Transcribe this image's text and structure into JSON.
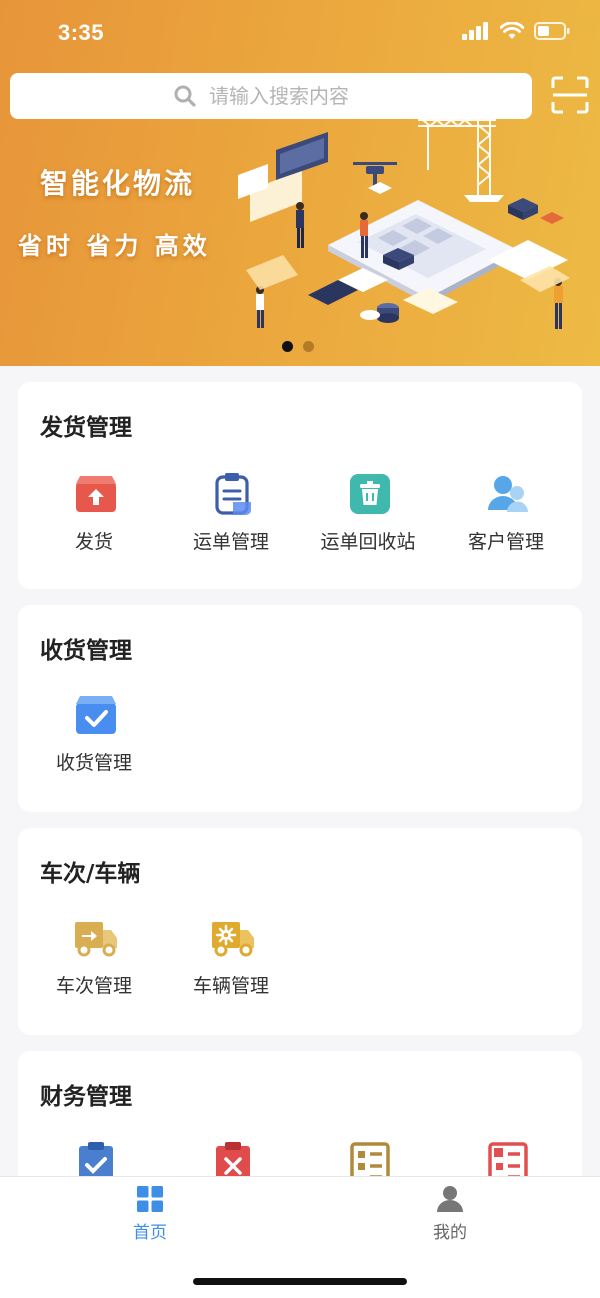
{
  "status_bar": {
    "time": "3:35"
  },
  "search": {
    "placeholder": "请输入搜索内容"
  },
  "banner": {
    "title": "智能化物流",
    "subtitle": "省时 省力 高效",
    "page_count": 2,
    "active_page": 1
  },
  "sections": [
    {
      "title": "发货管理",
      "items": [
        {
          "label": "发货",
          "icon": "ship-box-icon",
          "color": "#e8574b"
        },
        {
          "label": "运单管理",
          "icon": "clipboard-list-icon",
          "color": "#3d5ea8"
        },
        {
          "label": "运单回收站",
          "icon": "trash-icon",
          "color": "#3fb8ae"
        },
        {
          "label": "客户管理",
          "icon": "customers-icon",
          "color": "#57a7e8"
        }
      ]
    },
    {
      "title": "收货管理",
      "items": [
        {
          "label": "收货管理",
          "icon": "receive-box-icon",
          "color": "#4a8df0"
        }
      ]
    },
    {
      "title": "车次/车辆",
      "items": [
        {
          "label": "车次管理",
          "icon": "truck-arrow-icon",
          "color": "#d9ae52"
        },
        {
          "label": "车辆管理",
          "icon": "truck-gear-icon",
          "color": "#e0aa2e"
        }
      ]
    },
    {
      "title": "财务管理",
      "items": [
        {
          "icon": "clipboard-check-icon",
          "color": "#4a7fd0"
        },
        {
          "icon": "clipboard-x-icon",
          "color": "#e04b4b"
        },
        {
          "icon": "bill-list-icon",
          "color": "#b08a3a"
        },
        {
          "icon": "vehicle-bill-icon",
          "color": "#e05050"
        }
      ]
    }
  ],
  "tabbar": {
    "tabs": [
      {
        "label": "首页",
        "icon": "home-grid-icon",
        "active": true
      },
      {
        "label": "我的",
        "icon": "user-icon",
        "active": false
      }
    ],
    "active_color": "#3e8ee8",
    "inactive_color": "#666666"
  }
}
